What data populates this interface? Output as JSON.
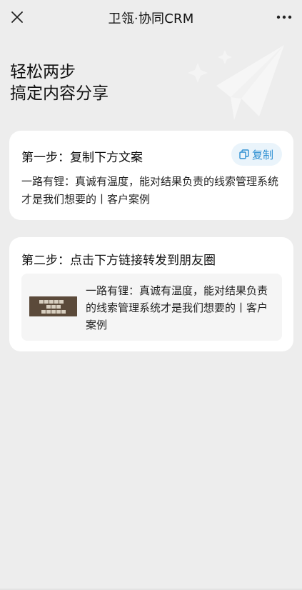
{
  "navbar": {
    "title": "卫瓴·协同CRM",
    "close_icon": "close-icon",
    "more_icon": "more-horizontal-icon"
  },
  "hero": {
    "line1": "轻松两步",
    "line2": "搞定内容分享",
    "decoration_icon": "paper-plane-icon"
  },
  "step1": {
    "title": "第一步：复制下方文案",
    "copy_label": "复制",
    "copy_icon": "copy-icon",
    "text": "一路有锂：真诚有温度，能对结果负责的线索管理系统才是我们想要的丨客户案例"
  },
  "step2": {
    "title": "第二步：点击下方链接转发到朋友圈",
    "link_text": "一路有锂：真诚有温度，能对结果负责的线索管理系统才是我们想要的丨客户案例",
    "thumbnail_icon": "article-thumbnail"
  },
  "colors": {
    "page_bg": "#ededed",
    "card_bg": "#ffffff",
    "accent": "#2d8fd2",
    "accent_bg": "#eaf4fb"
  }
}
